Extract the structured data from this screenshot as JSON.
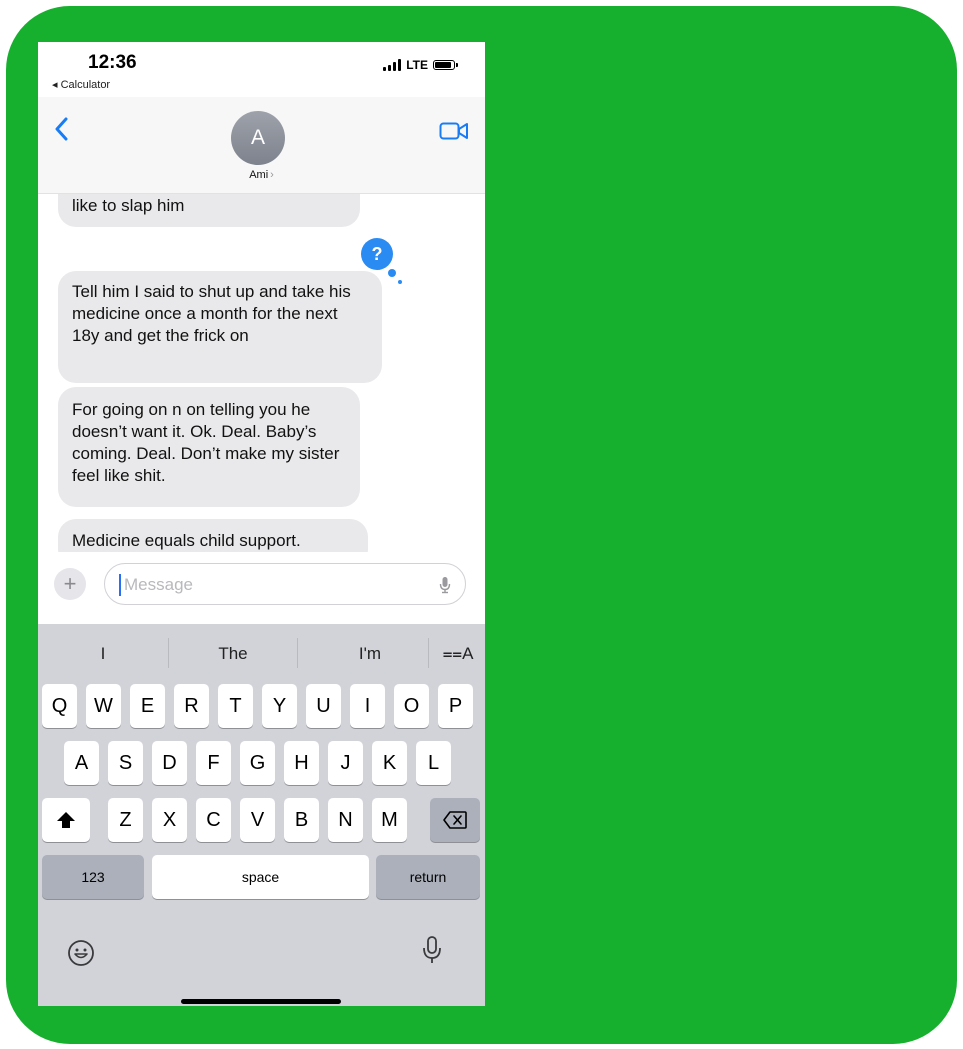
{
  "status": {
    "time": "12:36",
    "back_app": "◂ Calculator",
    "network": "LTE"
  },
  "header": {
    "avatar_initial": "A",
    "contact_name": "Ami",
    "chevron": "›"
  },
  "messages": [
    {
      "text": "like to slap him"
    },
    {
      "text": "Tell him I said to shut up and take his medicine once a month for the next 18y and get the frick on"
    },
    {
      "text": "For going on n on telling you he doesn’t want it. Ok. Deal. Baby’s coming. Deal. Don’t make my sister feel like shit."
    },
    {
      "text": "Medicine equals child support."
    }
  ],
  "tapback": {
    "symbol": "?"
  },
  "input": {
    "plus": "+",
    "placeholder": "Message"
  },
  "keyboard": {
    "suggestions": [
      "I",
      "The",
      "I'm"
    ],
    "format_key": "⩵A",
    "row1": [
      "Q",
      "W",
      "E",
      "R",
      "T",
      "Y",
      "U",
      "I",
      "O",
      "P"
    ],
    "row2": [
      "A",
      "S",
      "D",
      "F",
      "G",
      "H",
      "J",
      "K",
      "L"
    ],
    "row3": [
      "Z",
      "X",
      "C",
      "V",
      "B",
      "N",
      "M"
    ],
    "numbers_key": "123",
    "space_key": "space",
    "return_key": "return"
  },
  "colors": {
    "background": "#17b02e",
    "accent": "#2a8cf3",
    "bubble": "#e9e9eb"
  }
}
